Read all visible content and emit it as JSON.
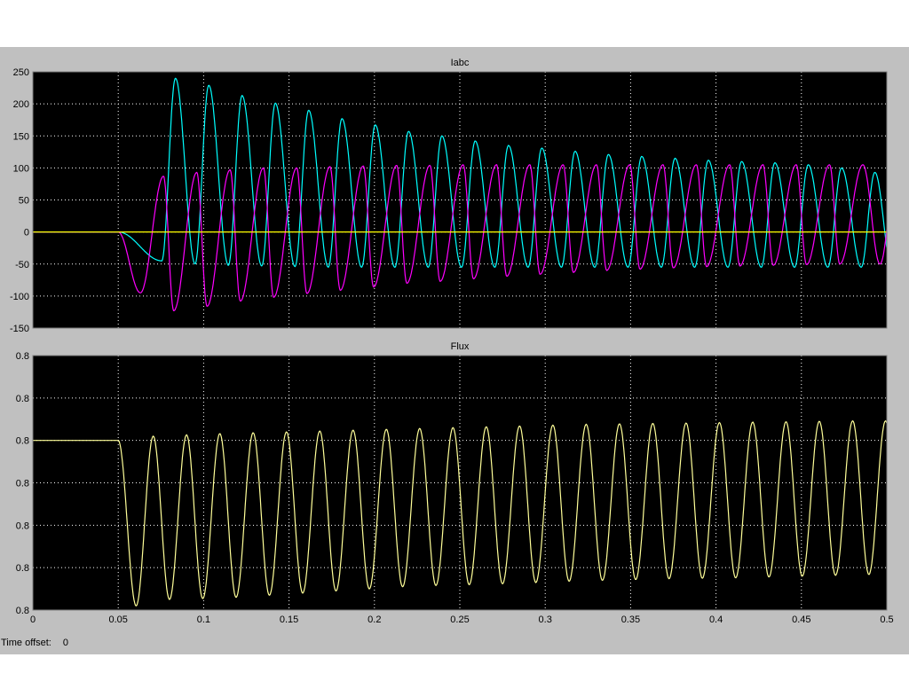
{
  "time_offset": {
    "label": "Time offset:",
    "value": "0"
  },
  "colors": {
    "figure_background": "#c0c0c0",
    "axes_background": "#000000",
    "grid": "#ffffff",
    "text": "#000000"
  },
  "chart_data": [
    {
      "type": "line",
      "title": "Iabc",
      "xlabel": "",
      "ylabel": "",
      "xlim": [
        0,
        0.5
      ],
      "ylim": [
        -150,
        250
      ],
      "grid": true,
      "xticks": [
        0,
        0.05,
        0.1,
        0.15,
        0.2,
        0.25,
        0.3,
        0.35,
        0.4,
        0.45,
        0.5
      ],
      "xtick_labels": [],
      "yticks": [
        250,
        200,
        150,
        100,
        50,
        0,
        -50,
        -100,
        -150
      ],
      "ytick_labels": [
        "250",
        "200",
        "150",
        "100",
        "50",
        "0",
        "-50",
        "-100",
        "-150"
      ],
      "fault_time": 0.05,
      "period": 0.02,
      "series": [
        {
          "color": "#00ffff",
          "peaks_x": [
            0.0835,
            0.103,
            0.1225,
            0.142,
            0.1615,
            0.181,
            0.2005,
            0.22,
            0.2395,
            0.259,
            0.2785,
            0.298,
            0.3175,
            0.337,
            0.3565,
            0.376,
            0.3955,
            0.415,
            0.4345,
            0.454,
            0.4735,
            0.493
          ],
          "peaks_y": [
            240,
            229,
            213,
            201,
            190,
            177,
            167,
            157,
            150,
            142,
            135,
            131,
            126,
            121,
            118,
            115,
            112,
            110,
            108,
            105,
            100,
            93
          ],
          "troughs_x": [
            0.0755,
            0.095,
            0.1145,
            0.134,
            0.1535,
            0.173,
            0.1925,
            0.212,
            0.2315,
            0.251,
            0.2705,
            0.29,
            0.3095,
            0.329,
            0.3485,
            0.368,
            0.3875,
            0.407,
            0.4265,
            0.446,
            0.4655,
            0.485
          ],
          "troughs_y": [
            -45,
            -50,
            -52,
            -53,
            -54,
            -55,
            -55,
            -55,
            -55,
            -55,
            -55,
            -55,
            -55,
            -55,
            -55,
            -55,
            -55,
            -55,
            -55,
            -55,
            -55,
            -55
          ]
        },
        {
          "color": "#ff00ff",
          "peaks_x": [
            0.0765,
            0.096,
            0.1155,
            0.135,
            0.1545,
            0.174,
            0.1935,
            0.213,
            0.2325,
            0.252,
            0.2715,
            0.291,
            0.3105,
            0.33,
            0.3495,
            0.369,
            0.3885,
            0.408,
            0.4275,
            0.447,
            0.4665,
            0.486
          ],
          "peaks_y": [
            87,
            93,
            97,
            100,
            100,
            102,
            103,
            104,
            104,
            105,
            105,
            105,
            105,
            105,
            105,
            105,
            105,
            105,
            105,
            105,
            105,
            105
          ],
          "troughs_x": [
            0.063,
            0.0825,
            0.102,
            0.1215,
            0.141,
            0.1605,
            0.18,
            0.1995,
            0.219,
            0.2385,
            0.258,
            0.2775,
            0.297,
            0.3165,
            0.336,
            0.3555,
            0.375,
            0.3945,
            0.414,
            0.4335,
            0.453,
            0.4725
          ],
          "troughs_y": [
            -95,
            -123,
            -116,
            -108,
            -102,
            -96,
            -91,
            -86,
            -80,
            -77,
            -73,
            -69,
            -66,
            -63,
            -60,
            -58,
            -56,
            -54,
            -53,
            -52,
            -51,
            -50
          ]
        },
        {
          "color": "#ffff00",
          "peaks_x": [],
          "peaks_y": [],
          "troughs_x": [],
          "troughs_y": []
        }
      ]
    },
    {
      "type": "line",
      "title": "Flux",
      "xlabel": "",
      "ylabel": "",
      "xlim": [
        0,
        0.5
      ],
      "ylim": [
        0,
        6
      ],
      "grid": true,
      "xticks": [
        0,
        0.05,
        0.1,
        0.15,
        0.2,
        0.25,
        0.3,
        0.35,
        0.4,
        0.45,
        0.5
      ],
      "xtick_labels": [
        "0",
        "0.05",
        "0.1",
        "0.15",
        "0.2",
        "0.25",
        "0.3",
        "0.35",
        "0.4",
        "0.45",
        "0.5"
      ],
      "yticks": [
        6,
        5,
        4,
        3,
        2,
        1,
        0
      ],
      "ytick_labels": [
        "0.8",
        "0.8",
        "0.8",
        "0.8",
        "0.8",
        "0.8",
        "0.8"
      ],
      "fault_time": 0.05,
      "period": 0.0195,
      "initial_level": 4,
      "series": [
        {
          "color": "#ffff99",
          "peaks_x": [
            0.0705,
            0.09,
            0.1095,
            0.129,
            0.1485,
            0.168,
            0.1875,
            0.207,
            0.2265,
            0.246,
            0.2655,
            0.285,
            0.3045,
            0.324,
            0.3435,
            0.363,
            0.3825,
            0.402,
            0.4215,
            0.441,
            0.4605,
            0.48
          ],
          "peaks_y": [
            4.1,
            4.13,
            4.16,
            4.18,
            4.2,
            4.22,
            4.24,
            4.26,
            4.28,
            4.3,
            4.32,
            4.34,
            4.36,
            4.38,
            4.39,
            4.4,
            4.41,
            4.42,
            4.43,
            4.44,
            4.45,
            4.46
          ],
          "troughs_x": [
            0.0605,
            0.08,
            0.0995,
            0.119,
            0.1385,
            0.158,
            0.1775,
            0.197,
            0.2165,
            0.236,
            0.2555,
            0.275,
            0.2945,
            0.314,
            0.3335,
            0.353,
            0.3725,
            0.392,
            0.4115,
            0.431,
            0.4505,
            0.47,
            0.4895
          ],
          "troughs_y": [
            0.1,
            0.25,
            0.27,
            0.3,
            0.35,
            0.4,
            0.45,
            0.5,
            0.55,
            0.58,
            0.6,
            0.62,
            0.65,
            0.68,
            0.7,
            0.72,
            0.74,
            0.75,
            0.76,
            0.78,
            0.8,
            0.82,
            0.84
          ]
        }
      ]
    }
  ]
}
